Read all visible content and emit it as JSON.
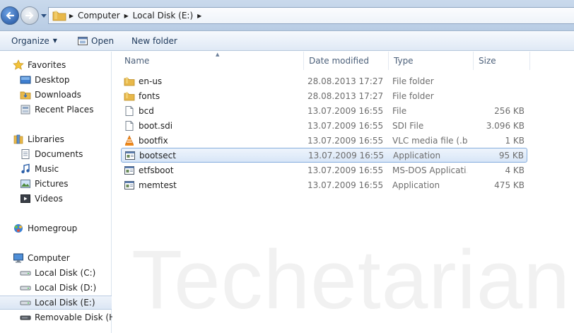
{
  "address": {
    "breadcrumbs": [
      "Computer",
      "Local Disk (E:)"
    ]
  },
  "toolbar": {
    "organize_label": "Organize",
    "open_label": "Open",
    "new_folder_label": "New folder"
  },
  "nav": {
    "favorites": {
      "label": "Favorites",
      "items": [
        {
          "label": "Desktop",
          "icon": "desktop-icon"
        },
        {
          "label": "Downloads",
          "icon": "downloads-icon"
        },
        {
          "label": "Recent Places",
          "icon": "recent-places-icon"
        }
      ]
    },
    "libraries": {
      "label": "Libraries",
      "items": [
        {
          "label": "Documents",
          "icon": "documents-icon"
        },
        {
          "label": "Music",
          "icon": "music-icon"
        },
        {
          "label": "Pictures",
          "icon": "pictures-icon"
        },
        {
          "label": "Videos",
          "icon": "videos-icon"
        }
      ]
    },
    "homegroup": {
      "label": "Homegroup"
    },
    "computer": {
      "label": "Computer",
      "items": [
        {
          "label": "Local Disk (C:)",
          "icon": "drive-icon"
        },
        {
          "label": "Local Disk (D:)",
          "icon": "drive-icon"
        },
        {
          "label": "Local Disk (E:)",
          "icon": "drive-icon",
          "selected": true
        },
        {
          "label": "Removable Disk (H:)",
          "icon": "removable-drive-icon"
        }
      ]
    }
  },
  "columns": {
    "name": "Name",
    "date": "Date modified",
    "type": "Type",
    "size": "Size"
  },
  "files": [
    {
      "name": "en-us",
      "date": "28.08.2013 17:27",
      "type": "File folder",
      "size": "",
      "icon": "folder-icon"
    },
    {
      "name": "fonts",
      "date": "28.08.2013 17:27",
      "type": "File folder",
      "size": "",
      "icon": "folder-icon"
    },
    {
      "name": "bcd",
      "date": "13.07.2009 16:55",
      "type": "File",
      "size": "256 KB",
      "icon": "file-icon"
    },
    {
      "name": "boot.sdi",
      "date": "13.07.2009 16:55",
      "type": "SDI File",
      "size": "3.096 KB",
      "icon": "file-icon"
    },
    {
      "name": "bootfix",
      "date": "13.07.2009 16:55",
      "type": "VLC media file (.bi...",
      "size": "1 KB",
      "icon": "vlc-icon"
    },
    {
      "name": "bootsect",
      "date": "13.07.2009 16:55",
      "type": "Application",
      "size": "95 KB",
      "icon": "application-icon",
      "selected": true
    },
    {
      "name": "etfsboot",
      "date": "13.07.2009 16:55",
      "type": "MS-DOS Applicati...",
      "size": "4 KB",
      "icon": "application-icon"
    },
    {
      "name": "memtest",
      "date": "13.07.2009 16:55",
      "type": "Application",
      "size": "475 KB",
      "icon": "application-icon"
    }
  ],
  "watermark": "Techetarian",
  "colors": {
    "selection_border": "#84acdd",
    "folder": "#e8b84a",
    "accent_blue": "#1f4f9a"
  }
}
